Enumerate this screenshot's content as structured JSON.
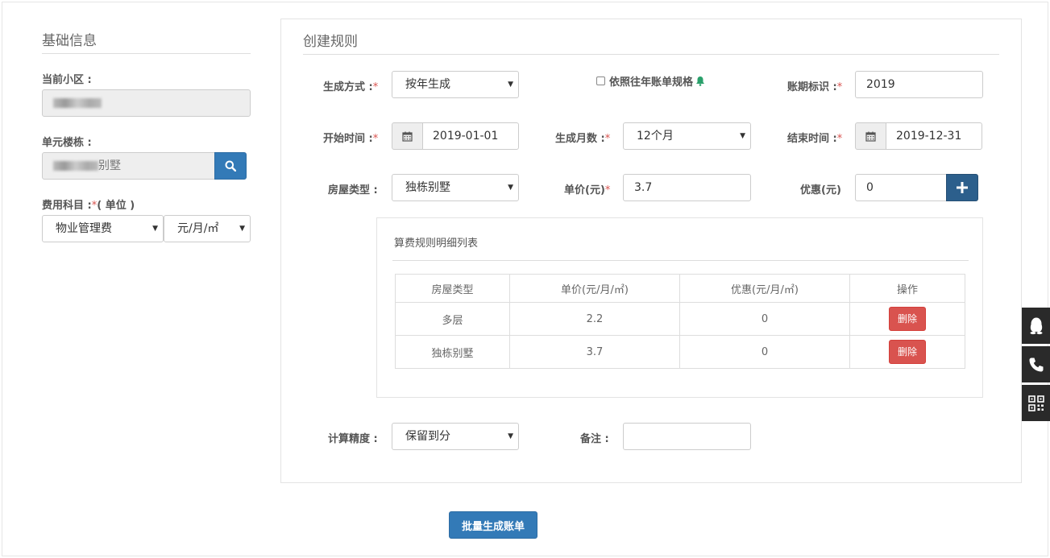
{
  "left": {
    "title": "基础信息",
    "community_label": "当前小区 :",
    "building_label": "单元楼栋 :",
    "building_suffix": "别墅",
    "fee_label": "费用科目 :",
    "fee_required": "*",
    "fee_unit_label": "( 单位 )",
    "fee_subject": "物业管理费",
    "fee_unit": "元/月/㎡"
  },
  "rule": {
    "title": "创建规则",
    "gen_method_label": "生成方式 :",
    "gen_method": "按年生成",
    "follow_prev_label": "依照往年账单规格",
    "period_label": "账期标识 :",
    "period": "2019",
    "start_label": "开始时间 :",
    "start": "2019-01-01",
    "months_label": "生成月数 :",
    "months": "12个月",
    "end_label": "结束时间 :",
    "end": "2019-12-31",
    "house_type_label": "房屋类型 :",
    "house_type": "独栋别墅",
    "price_label": "单价(元)",
    "price": "3.7",
    "discount_label": "优惠(元)",
    "discount": "0",
    "precision_label": "计算精度 :",
    "precision": "保留到分",
    "remark_label": "备注 :",
    "remark": "",
    "required_mark": "*"
  },
  "detail": {
    "title": "算费规则明细列表",
    "headers": [
      "房屋类型",
      "单价(元/月/㎡)",
      "优惠(元/月/㎡)",
      "操作"
    ],
    "rows": [
      {
        "type": "多层",
        "price": "2.2",
        "discount": "0",
        "action": "删除"
      },
      {
        "type": "独栋别墅",
        "price": "3.7",
        "discount": "0",
        "action": "删除"
      }
    ]
  },
  "footer": {
    "submit_label": "批量生成账单"
  },
  "colors": {
    "primary": "#337ab7",
    "danger": "#d9534f",
    "navy": "#2c5f8c"
  },
  "icons": [
    "search-icon",
    "calendar-icon",
    "bell-icon",
    "plus-icon",
    "qq-icon",
    "phone-icon",
    "qrcode-icon"
  ]
}
